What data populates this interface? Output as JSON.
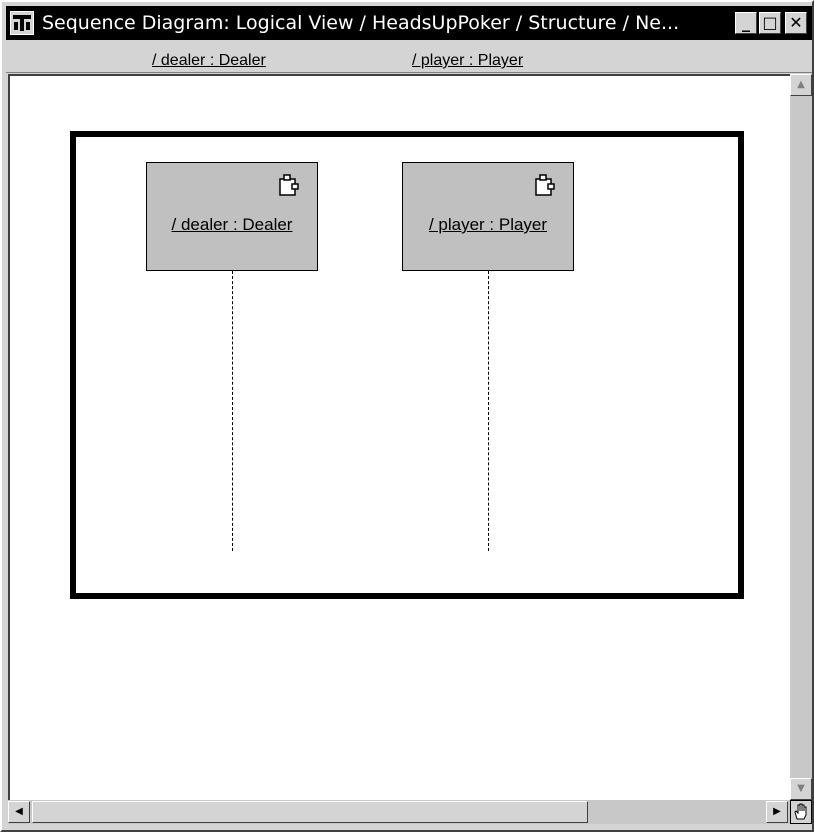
{
  "window": {
    "title": "Sequence Diagram: Logical View / HeadsUpPoker / Structure / Ne...",
    "minimize_label": "_",
    "maximize_label": "□",
    "close_label": "✕"
  },
  "header": {
    "columns": [
      {
        "label": "/ dealer : Dealer"
      },
      {
        "label": "/ player : Player"
      }
    ]
  },
  "diagram": {
    "lifelines": [
      {
        "label": "/ dealer : Dealer"
      },
      {
        "label": "/ player : Player"
      }
    ]
  },
  "scrollbars": {
    "up_arrow": "▲",
    "down_arrow": "▼",
    "left_arrow": "◀",
    "right_arrow": "▶",
    "corner_icon": "hand-pan-icon"
  }
}
